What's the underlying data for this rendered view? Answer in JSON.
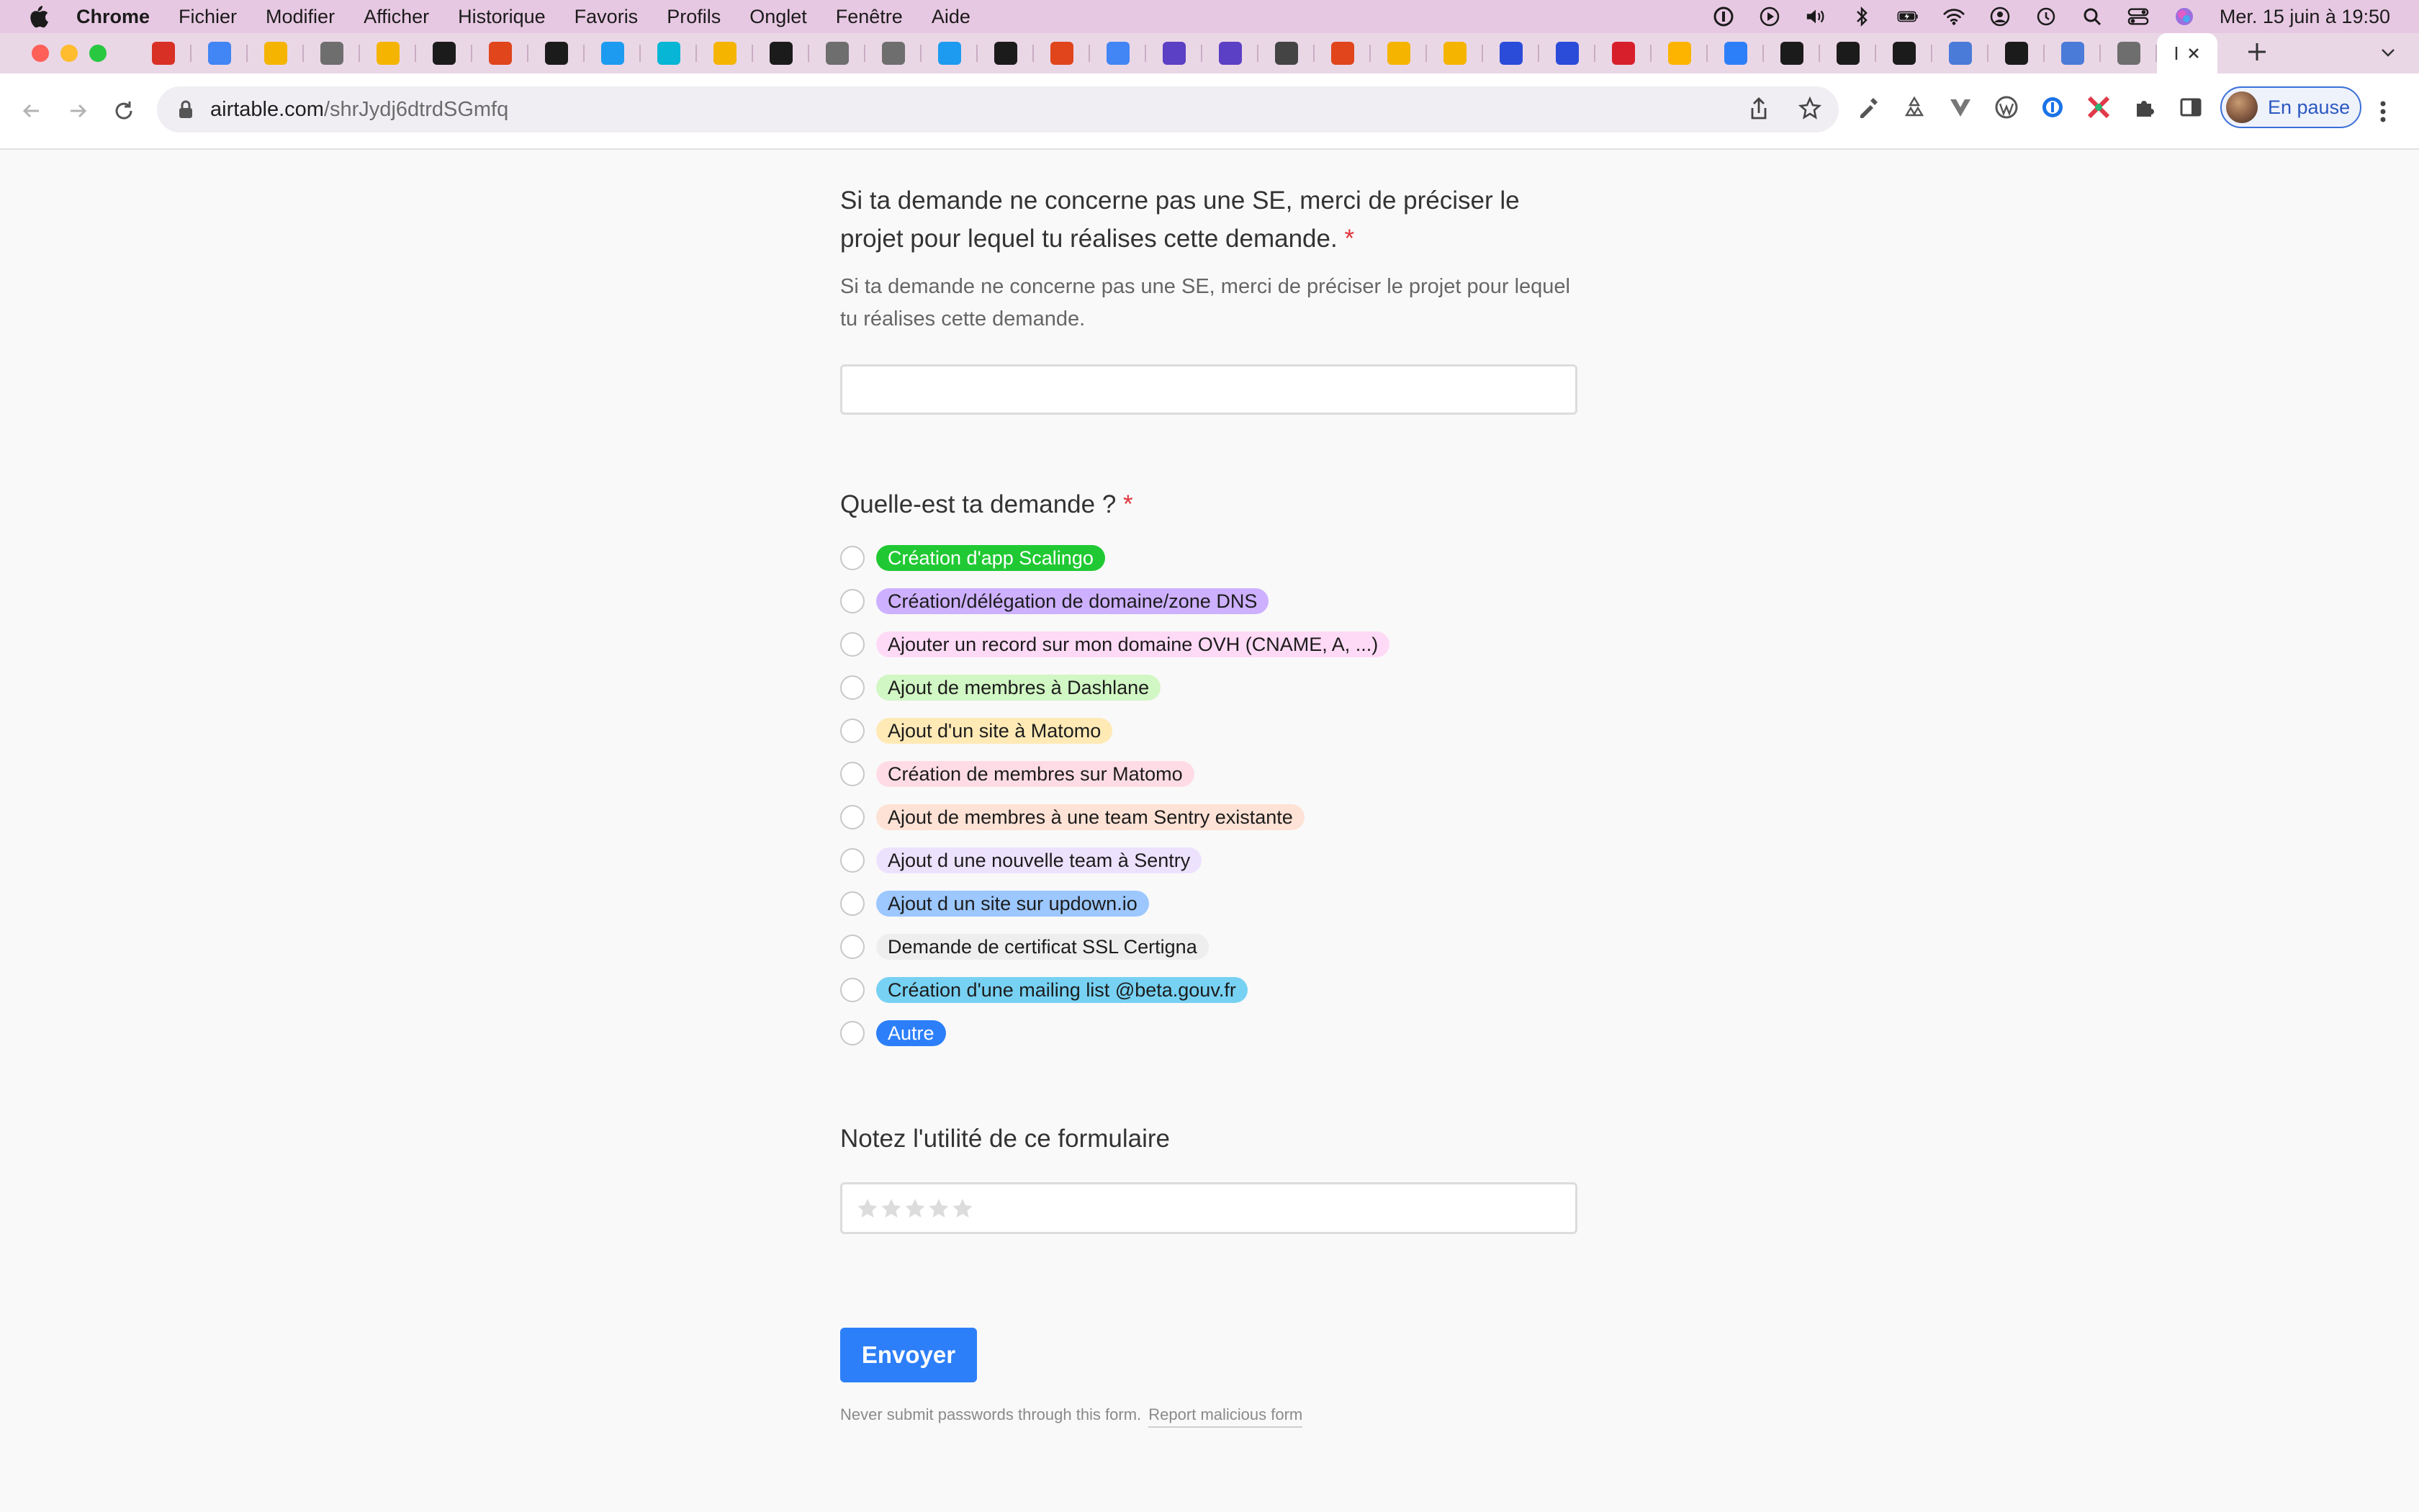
{
  "menubar": {
    "app": "Chrome",
    "items": [
      "Fichier",
      "Modifier",
      "Afficher",
      "Historique",
      "Favoris",
      "Profils",
      "Onglet",
      "Fenêtre",
      "Aide"
    ],
    "datetime": "Mer. 15 juin à  19:50"
  },
  "tabs": {
    "active_title": "I",
    "favicon_colors": [
      "#d93025",
      "#4285f4",
      "#f4b400",
      "#6e6e6e",
      "#f4b400",
      "#1b1b1b",
      "#e0451b",
      "#1b1b1b",
      "#1d9bf0",
      "#06b6d4",
      "#f4b400",
      "#1b1b1b",
      "#6e6e6e",
      "#6e6e6e",
      "#1d9bf0",
      "#1b1b1b",
      "#e0451b",
      "#4285f4",
      "#5b3fc4",
      "#5b3fc4",
      "#444444",
      "#e0451b",
      "#f4b400",
      "#f4b400",
      "#2b4bd9",
      "#2b4bd9",
      "#d71f2b",
      "#fcb400",
      "#2d7ff9",
      "#1b1b1b",
      "#1b1b1b",
      "#1b1b1b",
      "#4a7bd9",
      "#1b1b1b",
      "#4a7bd9",
      "#6e6e6e"
    ]
  },
  "toolbar": {
    "url_host": "airtable.com",
    "url_path": "/shrJydj6dtrdSGmfq",
    "profile_label": "En pause"
  },
  "form": {
    "q1": {
      "title": "Si ta demande ne concerne pas une SE, merci de préciser le projet pour lequel tu réalises cette demande.",
      "required_mark": "*",
      "description": "Si ta demande ne concerne pas une SE, merci de préciser le projet pour lequel tu réalises cette demande.",
      "value": ""
    },
    "q2": {
      "title": "Quelle-est ta demande ?",
      "required_mark": "*",
      "options": [
        {
          "label": "Création d'app Scalingo",
          "color": "#20c933",
          "text_color": "#ffffff"
        },
        {
          "label": "Création/délégation de domaine/zone DNS",
          "color": "#cdb0ff",
          "text_color": "#1c1c1c"
        },
        {
          "label": "Ajouter un record sur mon domaine OVH (CNAME, A, ...)",
          "color": "#ffdaf6",
          "text_color": "#1c1c1c"
        },
        {
          "label": "Ajout de membres à Dashlane",
          "color": "#d1f7c4",
          "text_color": "#1c1c1c"
        },
        {
          "label": "Ajout d'un site à Matomo",
          "color": "#ffeab6",
          "text_color": "#1c1c1c"
        },
        {
          "label": "Création de membres sur Matomo",
          "color": "#ffdce5",
          "text_color": "#1c1c1c"
        },
        {
          "label": "Ajout de membres à une team Sentry existante",
          "color": "#fee2d5",
          "text_color": "#1c1c1c"
        },
        {
          "label": "Ajout d une nouvelle team à Sentry",
          "color": "#ede2fe",
          "text_color": "#1c1c1c"
        },
        {
          "label": "Ajout d un site sur updown.io",
          "color": "#9cc7ff",
          "text_color": "#1c1c1c"
        },
        {
          "label": "Demande de certificat SSL Certigna",
          "color": "#eeeeee",
          "text_color": "#1c1c1c"
        },
        {
          "label": "Création d'une mailing list @beta.gouv.fr",
          "color": "#77d1f3",
          "text_color": "#1c1c1c"
        },
        {
          "label": "Autre",
          "color": "#2d7ff9",
          "text_color": "#ffffff"
        }
      ]
    },
    "q3": {
      "title": "Notez l'utilité de ce formulaire",
      "rating_value": 0,
      "rating_max": 5
    },
    "submit_label": "Envoyer",
    "footer_text": "Never submit passwords through this form.",
    "footer_link": "Report malicious form"
  }
}
